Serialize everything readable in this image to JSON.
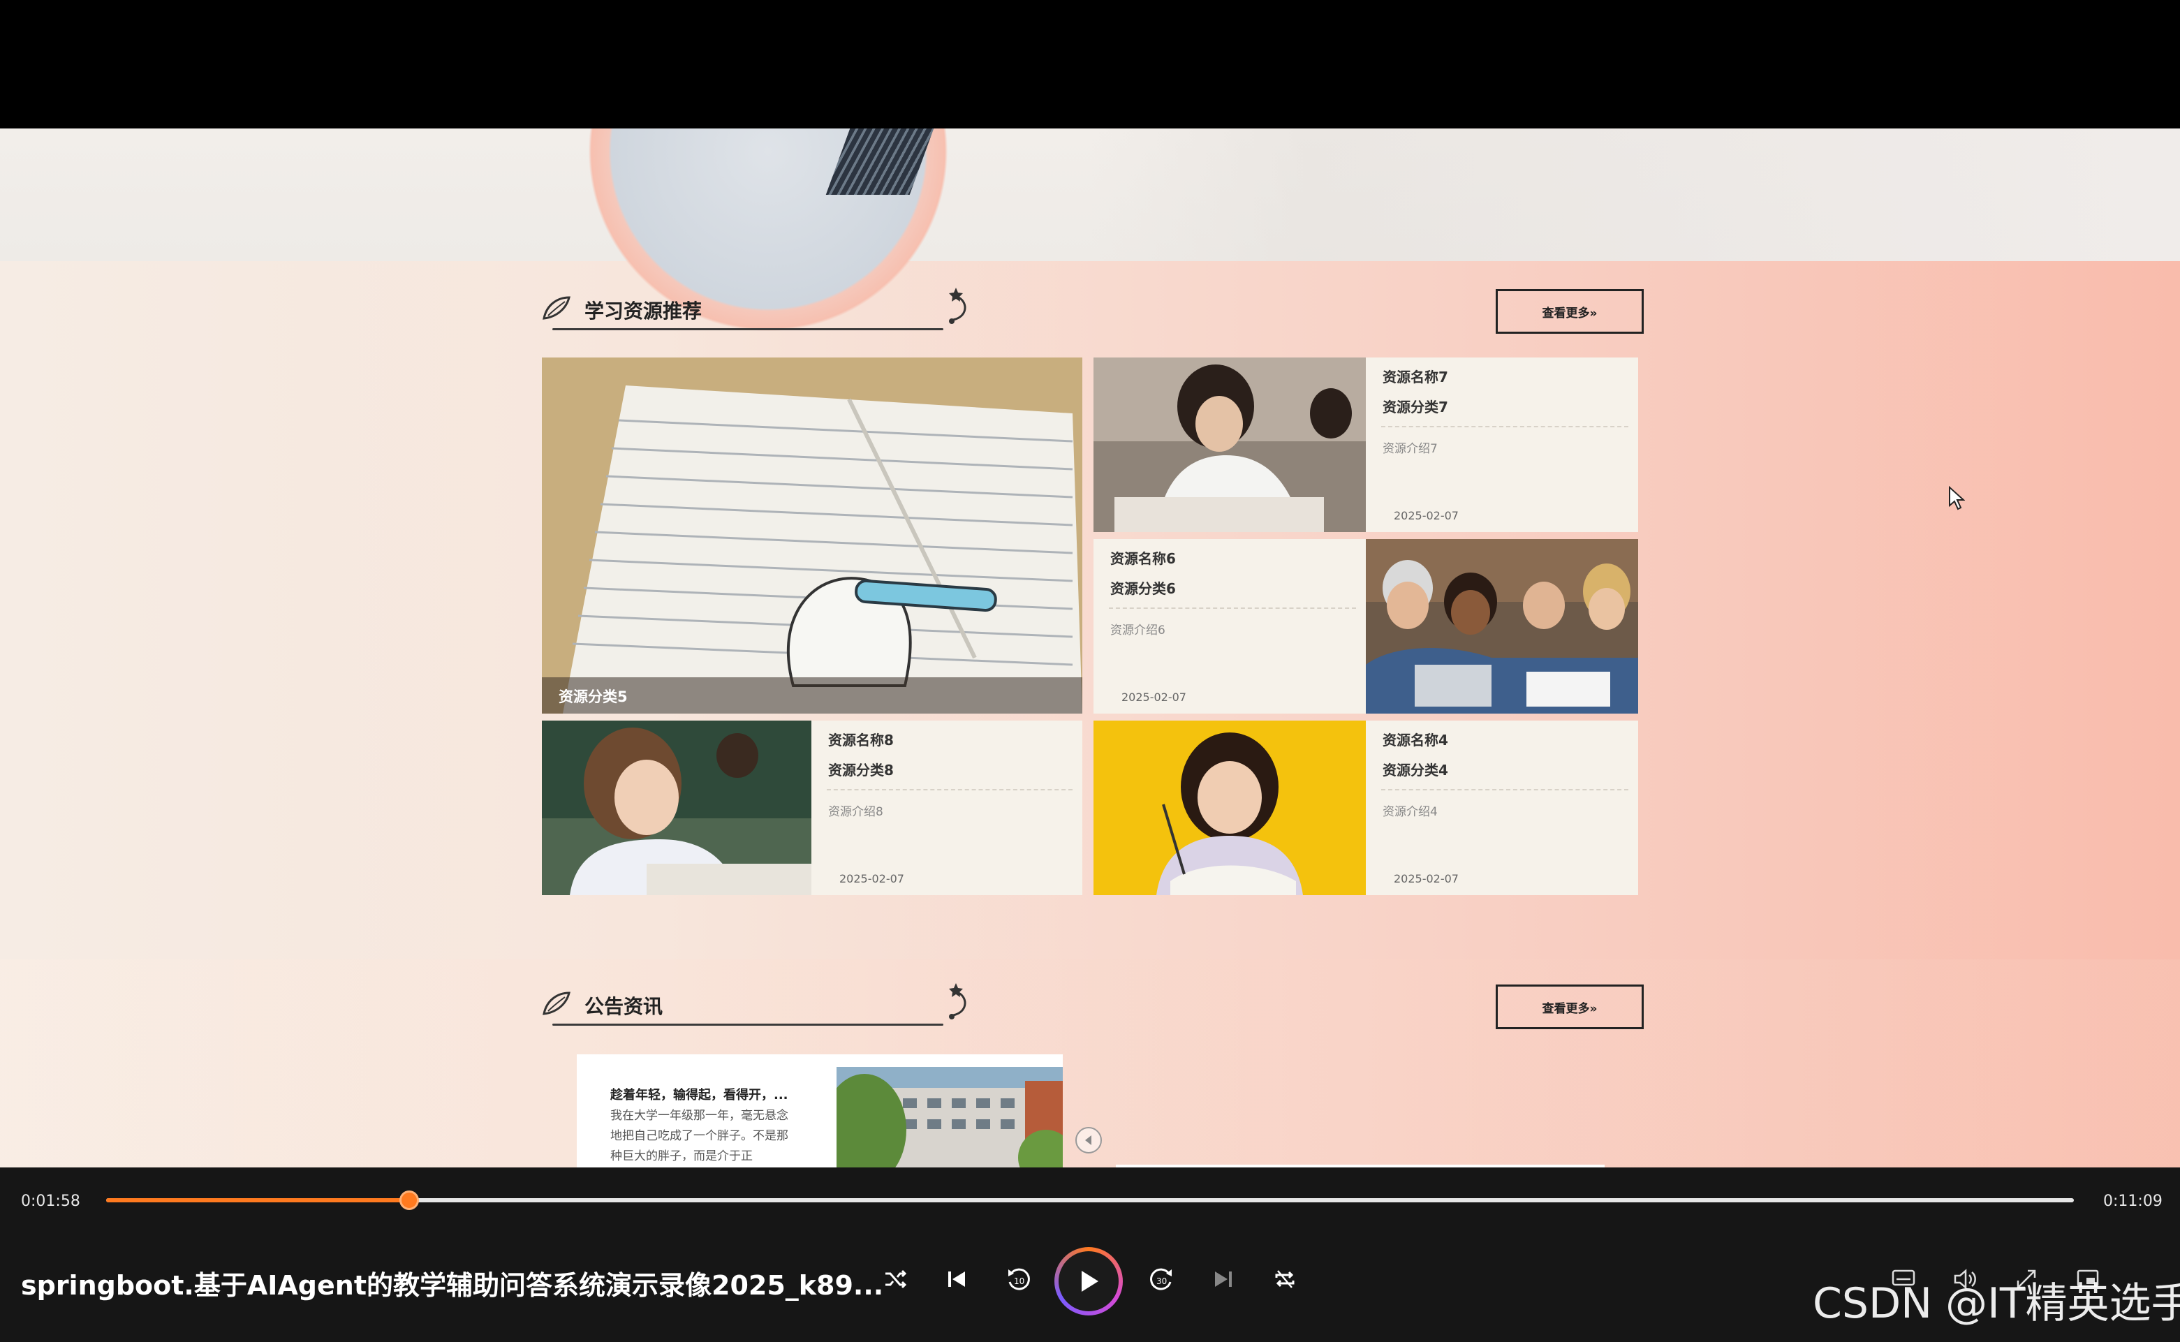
{
  "section1": {
    "title": "学习资源推荐",
    "more_label": "查看更多»"
  },
  "section2": {
    "title": "公告资讯",
    "more_label": "查看更多»"
  },
  "big_card": {
    "category": "资源分类5"
  },
  "cards": [
    {
      "name": "资源名称7",
      "category": "资源分类7",
      "intro": "资源介绍7",
      "date": "2025-02-07"
    },
    {
      "name": "资源名称6",
      "category": "资源分类6",
      "intro": "资源介绍6",
      "date": "2025-02-07"
    },
    {
      "name": "资源名称8",
      "category": "资源分类8",
      "intro": "资源介绍8",
      "date": "2025-02-07"
    },
    {
      "name": "资源名称4",
      "category": "资源分类4",
      "intro": "资源介绍4",
      "date": "2025-02-07"
    }
  ],
  "notice": {
    "title": "趁着年轻，输得起，看得开，...",
    "body": "我在大学一年级那一年，毫无悬念地把自己吃成了一个胖子。不是那种巨大的胖子，而是介于正"
  },
  "player": {
    "current_time": "0:01:58",
    "total_time": "0:11:09",
    "progress": 0.154,
    "video_title": "springboot.基于AIAgent的教学辅助问答系统演示录像2025_k89...",
    "accent_color": "#ff7a1f"
  },
  "watermark": "CSDN @IT精英选手"
}
